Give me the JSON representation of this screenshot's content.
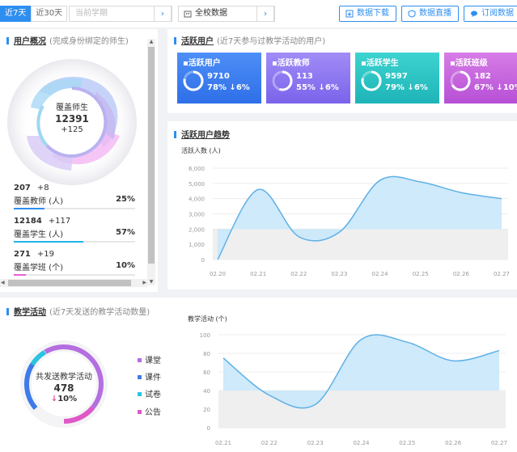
{
  "toolbar": {
    "period_tabs": [
      "近7天",
      "近30天"
    ],
    "semester": {
      "placeholder": "当前学期"
    },
    "school": {
      "value": "全校数据"
    },
    "actions": [
      {
        "label": "数据下载",
        "icon": "download-icon"
      },
      {
        "label": "数据直播",
        "icon": "shield-icon"
      },
      {
        "label": "订阅数据",
        "icon": "chat-icon"
      }
    ],
    "accent": "#2e8ef0"
  },
  "user_overview": {
    "title": "用户概况",
    "subtitle": "(完成身份绑定的师生)",
    "center": {
      "label": "覆盖师生",
      "value": "12391",
      "delta": "+125"
    },
    "stats": [
      {
        "value": "207",
        "delta": "+8",
        "label": "覆盖教师 (人)",
        "percent": "25%",
        "ratio": 0.25,
        "color": "#2e8ef0"
      },
      {
        "value": "12184",
        "delta": "+117",
        "label": "覆盖学生 (人)",
        "percent": "57%",
        "ratio": 0.57,
        "color": "#20b3e6"
      },
      {
        "value": "271",
        "delta": "+19",
        "label": "覆盖学班 (个)",
        "percent": "10%",
        "ratio": 0.1,
        "color": "#e45fd6"
      }
    ]
  },
  "active_users": {
    "title": "活跃用户",
    "subtitle": "(近7天参与过教学活动的用户)",
    "cards": [
      {
        "title": "活跃用户",
        "value": "9710",
        "percent": "78%",
        "trend": "6%",
        "ratio": 0.78,
        "from": "#4d8ef7",
        "to": "#2f6fe8"
      },
      {
        "title": "活跃教师",
        "value": "113",
        "percent": "55%",
        "trend": "6%",
        "ratio": 0.55,
        "from": "#a18cf7",
        "to": "#7b63ea"
      },
      {
        "title": "活跃学生",
        "value": "9597",
        "percent": "79%",
        "trend": "6%",
        "ratio": 0.79,
        "from": "#3cd3d0",
        "to": "#1fb4b8"
      },
      {
        "title": "活跃班级",
        "value": "182",
        "percent": "67%",
        "trend": "10%",
        "ratio": 0.67,
        "from": "#d77ce6",
        "to": "#b650d6"
      }
    ]
  },
  "trend": {
    "title": "活跃用户趋势",
    "ylabel": "活跃人数 (人)"
  },
  "teaching": {
    "title": "教学活动",
    "subtitle": "(近7天发送的教学活动数量)",
    "center": {
      "label": "共发送教学活动",
      "value": "478",
      "trend": "10%"
    },
    "legend": [
      {
        "label": "课堂",
        "color": "#b56ee0"
      },
      {
        "label": "课件",
        "color": "#3f7be8"
      },
      {
        "label": "试卷",
        "color": "#2cc3e0"
      },
      {
        "label": "公告",
        "color": "#e058c8"
      }
    ],
    "ylabel": "教学活动 (个)"
  },
  "chart_data": [
    {
      "type": "area",
      "title": "",
      "ylabel": "活跃人数 (人)",
      "x": [
        "02.20",
        "02.21",
        "02.22",
        "02.23",
        "02.24",
        "02.25",
        "02.26",
        "02.27"
      ],
      "ylim": [
        0,
        6000
      ],
      "yticks": [
        0,
        1000,
        2000,
        3000,
        4000,
        5000,
        6000
      ],
      "series": [
        {
          "values": [
            0,
            4600,
            1500,
            1800,
            5200,
            5100,
            4400,
            4000
          ]
        }
      ],
      "grid": true
    },
    {
      "type": "area",
      "title": "",
      "ylabel": "教学活动 (个)",
      "x": [
        "02.21",
        "02.22",
        "02.23",
        "02.24",
        "02.25",
        "02.26",
        "02.27"
      ],
      "ylim": [
        0,
        100
      ],
      "yticks": [
        0,
        20,
        40,
        60,
        80,
        100
      ],
      "series": [
        {
          "values": [
            75,
            35,
            25,
            95,
            92,
            72,
            83
          ]
        }
      ],
      "grid": true
    }
  ]
}
